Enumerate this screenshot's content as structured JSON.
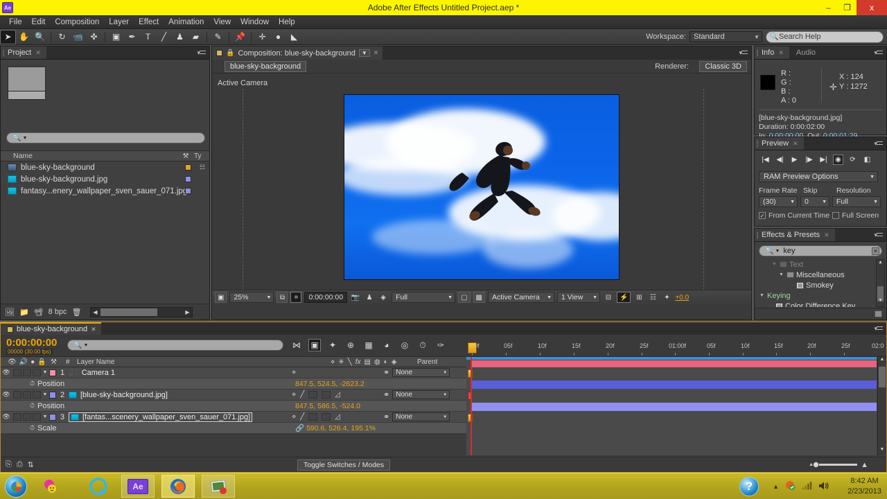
{
  "titlebar": {
    "app_icon": "ae-logo",
    "title": "Adobe After Effects   Untitled Project.aep *",
    "minimize": "–",
    "maximize": "❐",
    "close": "x"
  },
  "menubar": {
    "items": [
      "File",
      "Edit",
      "Composition",
      "Layer",
      "Effect",
      "Animation",
      "View",
      "Window",
      "Help"
    ]
  },
  "toolbar": {
    "tools": [
      {
        "name": "selection-tool",
        "glyph": "➤",
        "selected": true
      },
      {
        "name": "hand-tool",
        "glyph": "✋",
        "selected": false
      },
      {
        "name": "zoom-tool",
        "glyph": "🔍",
        "selected": false
      },
      {
        "name": "rotation-tool",
        "glyph": "↻",
        "selected": false
      },
      {
        "name": "camera-tool",
        "glyph": "📹",
        "selected": false
      },
      {
        "name": "pan-behind-tool",
        "glyph": "✜",
        "selected": false
      },
      {
        "name": "shape-tool",
        "glyph": "▣",
        "selected": false
      },
      {
        "name": "pen-tool",
        "glyph": "✒",
        "selected": false
      },
      {
        "name": "type-tool",
        "glyph": "T",
        "selected": false
      },
      {
        "name": "brush-tool",
        "glyph": "╱",
        "selected": false
      },
      {
        "name": "clone-stamp-tool",
        "glyph": "♟",
        "selected": false
      },
      {
        "name": "eraser-tool",
        "glyph": "▰",
        "selected": false
      },
      {
        "name": "roto-brush-tool",
        "glyph": "✎",
        "selected": false
      },
      {
        "name": "puppet-pin-tool",
        "glyph": "📌",
        "selected": false
      }
    ],
    "extra_tools": [
      {
        "name": "move-anchor-icon",
        "glyph": "✛"
      },
      {
        "name": "dot-icon",
        "glyph": "●"
      },
      {
        "name": "mask-icon",
        "glyph": "◣"
      }
    ],
    "workspace_label": "Workspace:",
    "workspace_value": "Standard",
    "search_help_placeholder": "Search Help"
  },
  "project": {
    "tab_label": "Project",
    "search_placeholder": "",
    "columns": {
      "name": "Name",
      "tag": "tag-icon",
      "type": "Ty"
    },
    "items": [
      {
        "name": "blue-sky-background",
        "icon": "composition-icon",
        "swatch": "#e0a326",
        "type_icon": "comp-tree-icon"
      },
      {
        "name": "blue-sky-background.jpg",
        "icon": "footage-icon",
        "swatch": "#8d8fe8",
        "type_icon": ""
      },
      {
        "name": "fantasy...enery_wallpaper_sven_sauer_071.jpg",
        "icon": "footage-icon",
        "swatch": "#8d8fe8",
        "type_icon": ""
      }
    ],
    "footer": {
      "bit_depth": "8 bpc",
      "icons": [
        "interpret-footage-icon",
        "new-folder-icon",
        "new-comp-icon",
        "delete-icon"
      ]
    }
  },
  "composition": {
    "tab_label": "Composition: blue-sky-background",
    "comp_name": "blue-sky-background",
    "renderer_label": "Renderer:",
    "renderer_value": "Classic 3D",
    "view_label": "Active Camera",
    "bottom_bar": {
      "magnification": "25%",
      "timecode": "0:00:00:00",
      "resolution": "Full",
      "camera_view": "Active Camera",
      "view_layout": "1 View",
      "exposure": "+0.0",
      "icons": [
        "always-preview-icon",
        "region-of-interest-icon",
        "title-safe-icon",
        "take-snapshot-icon",
        "show-snapshot-icon",
        "channel-icon",
        "transparency-grid-icon",
        "timeline-icon",
        "comp-flowchart-icon",
        "reset-exposure-icon"
      ]
    },
    "stage": {
      "description": "Man in dark suit leaping across a bright blue sky with white clouds",
      "sky_color": "#0b63e8",
      "cloud_color": "#ffffff",
      "figure_color": "#1c1d22"
    }
  },
  "info": {
    "tab_label": "Info",
    "tab_label_2": "Audio",
    "channels": [
      {
        "label": "R :",
        "value": ""
      },
      {
        "label": "G :",
        "value": ""
      },
      {
        "label": "B :",
        "value": ""
      },
      {
        "label": "A :",
        "value": "0"
      }
    ],
    "x_label": "X : 124",
    "y_label": "Y : 1272",
    "file_name": "[blue-sky-background.jpg]",
    "duration": "Duration: 0:00:02:00",
    "in_out_prefix": "In: ",
    "in_value": "0:00:00:00",
    "out_prefix": ", Out: ",
    "out_value": "0:00:01:29"
  },
  "preview": {
    "tab_label": "Preview",
    "transport": [
      {
        "name": "first-frame-button",
        "glyph": "|◀"
      },
      {
        "name": "previous-frame-button",
        "glyph": "◀|"
      },
      {
        "name": "play-button",
        "glyph": "▶"
      },
      {
        "name": "next-frame-button",
        "glyph": "|▶"
      },
      {
        "name": "last-frame-button",
        "glyph": "▶|"
      },
      {
        "name": "ram-preview-button",
        "glyph": "◉"
      },
      {
        "name": "loop-button",
        "glyph": "⟳"
      },
      {
        "name": "audio-button",
        "glyph": "◧"
      }
    ],
    "options_label": "RAM Preview Options",
    "frame_rate_label": "Frame Rate",
    "frame_rate_value": "(30)",
    "skip_label": "Skip",
    "skip_value": "0",
    "resolution_label": "Resolution",
    "resolution_value": "Full",
    "from_current_time": "From Current Time",
    "from_current_time_checked": true,
    "full_screen": "Full Screen",
    "full_screen_checked": false
  },
  "effects": {
    "tab_label": "Effects & Presets",
    "search_value": "key",
    "tree": [
      {
        "label": "Text",
        "depth": 1,
        "kind": "folder",
        "expanded": true,
        "dim": true
      },
      {
        "label": "Miscellaneous",
        "depth": 2,
        "kind": "folder",
        "expanded": true
      },
      {
        "label": "Smokey",
        "depth": 3,
        "kind": "effect"
      },
      {
        "label": "Keying",
        "depth": 0,
        "kind": "category",
        "expanded": true
      },
      {
        "label": "Color Difference Key",
        "depth": 1,
        "kind": "effect"
      }
    ]
  },
  "timeline": {
    "tab_label": "blue-sky-background",
    "timecode": "0:00:00:00",
    "timecode_sub": "00000 (30.00 fps)",
    "search_placeholder": "",
    "toolbar_icons": [
      {
        "name": "composition-mini-flowchart-icon",
        "glyph": "⋈"
      },
      {
        "name": "draft-3d-icon",
        "glyph": "▣",
        "active": true
      },
      {
        "name": "hide-shy-layers-icon",
        "glyph": "✦"
      },
      {
        "name": "enable-frame-blending-icon",
        "glyph": "⊕"
      },
      {
        "name": "motion-blur-icon",
        "glyph": "▦"
      },
      {
        "name": "brainstorm-icon",
        "glyph": "◕"
      },
      {
        "name": "graph-editor-icon",
        "glyph": "◎"
      },
      {
        "name": "auto-keyframe-icon",
        "glyph": "⏱"
      },
      {
        "name": "layer-edit-icon",
        "glyph": "✑"
      }
    ],
    "column_headers": {
      "av_features": [
        "eye-icon",
        "audio-icon",
        "solo-icon",
        "lock-icon"
      ],
      "label": "label-icon",
      "number": "#",
      "layer_name": "Layer Name",
      "switches": [
        "shy-icon",
        "collapse-icon",
        "quality-icon",
        "effects-icon",
        "frame-blend-icon",
        "motion-blur-icon",
        "adjustment-icon",
        "3d-layer-icon"
      ],
      "parent": "Parent"
    },
    "layers": [
      {
        "index": "1",
        "name": "Camera 1",
        "label_color": "#f58fa8",
        "bar_color": "#e8637f",
        "type": "camera",
        "selected": false,
        "parent": "None",
        "property": {
          "name": "Position",
          "value": "847.5, 524.5, -2623.2",
          "linked": false
        }
      },
      {
        "index": "2",
        "name": "[blue-sky-background.jpg]",
        "label_color": "#8d8fe8",
        "bar_color": "#5a5ed8",
        "type": "footage",
        "selected": false,
        "parent": "None",
        "property": {
          "name": "Position",
          "value": "847.5, 586.5, -524.0",
          "linked": false
        }
      },
      {
        "index": "3",
        "name": "[fantas...scenery_wallpaper_sven_sauer_071.jpg]",
        "label_color": "#8d8fe8",
        "bar_color": "#8f90f0",
        "type": "footage",
        "selected": true,
        "parent": "None",
        "property": {
          "name": "Scale",
          "value": "590.6, 526.4, 195.1%",
          "linked": true
        }
      }
    ],
    "ruler_ticks": [
      "00f",
      "05f",
      "10f",
      "15f",
      "20f",
      "25f",
      "01:00f",
      "05f",
      "10f",
      "15f",
      "20f",
      "25f",
      "02:0"
    ],
    "footer": {
      "toggle_label": "Toggle Switches / Modes",
      "icons": [
        "frame-render-icon",
        "motion-blur-icon",
        "transform-icon"
      ]
    }
  },
  "taskbar": {
    "start": "start-orb",
    "quick_launch": [
      {
        "name": "yahoo-messenger-icon",
        "glyph": "☻"
      },
      {
        "name": "quicktime-icon",
        "glyph": "◔"
      }
    ],
    "apps": [
      {
        "name": "after-effects-taskbar-button",
        "label": "Ae",
        "active": false
      },
      {
        "name": "firefox-taskbar-button",
        "label": "",
        "active": true
      },
      {
        "name": "photo-viewer-taskbar-button",
        "label": "",
        "active": false
      }
    ],
    "tray": [
      {
        "name": "show-hidden-icons",
        "glyph": "▲"
      },
      {
        "name": "antivirus-icon",
        "glyph": "◍"
      },
      {
        "name": "network-icon",
        "glyph": "▂▄▆"
      },
      {
        "name": "volume-icon",
        "glyph": "🔊"
      }
    ],
    "help_glyph": "?",
    "time": "8:42 AM",
    "date": "2/23/2013"
  }
}
